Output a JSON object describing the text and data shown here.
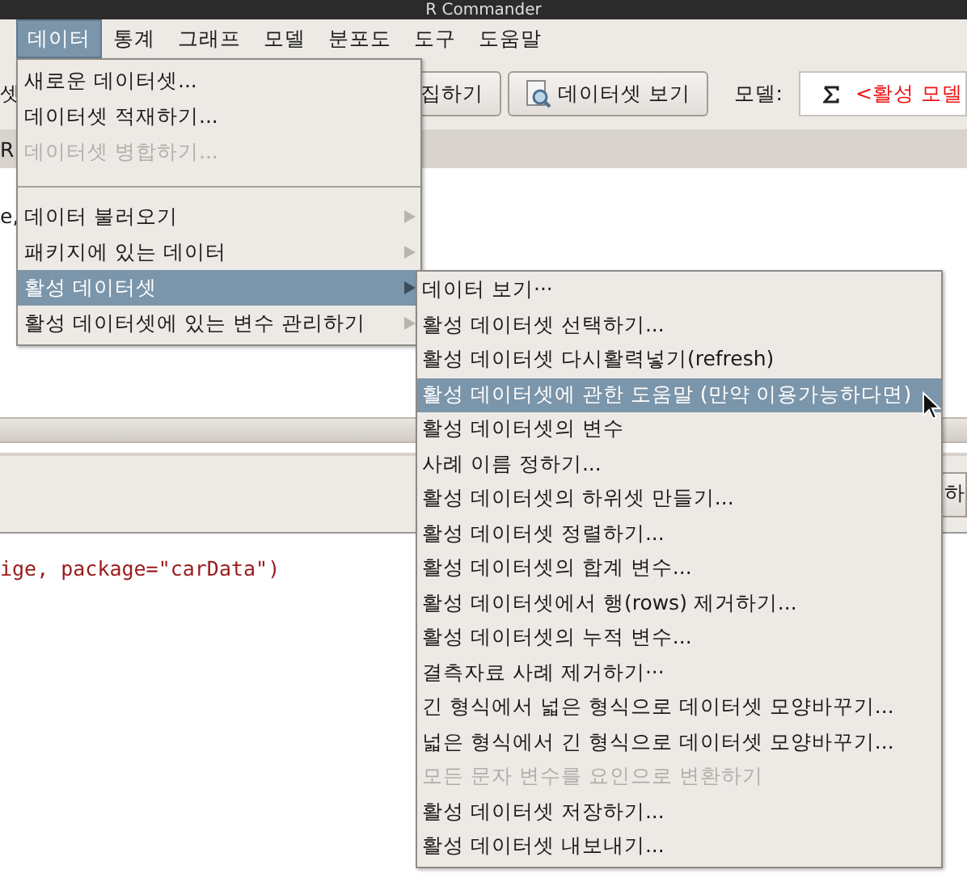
{
  "window": {
    "title": "R Commander"
  },
  "menubar": [
    {
      "label": "데이터",
      "selected": true
    },
    {
      "label": "통계",
      "selected": false
    },
    {
      "label": "그래프",
      "selected": false
    },
    {
      "label": "모델",
      "selected": false
    },
    {
      "label": "분포도",
      "selected": false
    },
    {
      "label": "도구",
      "selected": false
    },
    {
      "label": "도움말",
      "selected": false
    }
  ],
  "toolbar": {
    "fragment": "셋",
    "edit_button": "집하기",
    "view_button": "데이터셋 보기",
    "model_label": "모델:",
    "model_value": "<활성 모델"
  },
  "script_tab_fragment": "R",
  "script_text": "e,",
  "run_button": "하",
  "output_line": "ige, package=\"carData\")",
  "data_menu": [
    {
      "kind": "item",
      "label": "새로운 데이터셋...",
      "disabled": false,
      "submenu": false,
      "selected": false
    },
    {
      "kind": "item",
      "label": "데이터셋 적재하기...",
      "disabled": false,
      "submenu": false,
      "selected": false
    },
    {
      "kind": "item",
      "label": "데이터셋 병합하기...",
      "disabled": true,
      "submenu": false,
      "selected": false
    },
    {
      "kind": "separator"
    },
    {
      "kind": "item",
      "label": "데이터 불러오기",
      "disabled": false,
      "submenu": true,
      "selected": false
    },
    {
      "kind": "item",
      "label": "패키지에 있는 데이터",
      "disabled": false,
      "submenu": true,
      "selected": false
    },
    {
      "kind": "item",
      "label": "활성 데이터셋",
      "disabled": false,
      "submenu": true,
      "selected": true
    },
    {
      "kind": "item",
      "label": "활성 데이터셋에 있는 변수 관리하기",
      "disabled": false,
      "submenu": true,
      "selected": false
    }
  ],
  "active_dataset_menu": [
    {
      "label": "데이터 보기···",
      "disabled": false,
      "selected": false
    },
    {
      "label": "활성 데이터셋 선택하기...",
      "disabled": false,
      "selected": false
    },
    {
      "label": "활성 데이터셋 다시활력넣기(refresh)",
      "disabled": false,
      "selected": false
    },
    {
      "label": "활성 데이터셋에 관한 도움말 (만약 이용가능하다면)",
      "disabled": false,
      "selected": true
    },
    {
      "label": "활성 데이터셋의 변수",
      "disabled": false,
      "selected": false
    },
    {
      "label": "사례 이름 정하기...",
      "disabled": false,
      "selected": false
    },
    {
      "label": "활성 데이터셋의 하위셋 만들기...",
      "disabled": false,
      "selected": false
    },
    {
      "label": "활성 데이터셋 정렬하기...",
      "disabled": false,
      "selected": false
    },
    {
      "label": "활성 데이터셋의 합계 변수...",
      "disabled": false,
      "selected": false
    },
    {
      "label": "활성 데이터셋에서 행(rows) 제거하기...",
      "disabled": false,
      "selected": false
    },
    {
      "label": "활성 데이터셋의 누적 변수...",
      "disabled": false,
      "selected": false
    },
    {
      "label": "결측자료 사례 제거하기···",
      "disabled": false,
      "selected": false
    },
    {
      "label": "긴 형식에서 넓은 형식으로 데이터셋 모양바꾸기...",
      "disabled": false,
      "selected": false
    },
    {
      "label": "넓은 형식에서 긴 형식으로 데이터셋 모양바꾸기...",
      "disabled": false,
      "selected": false
    },
    {
      "label": "모든 문자 변수를 요인으로 변환하기",
      "disabled": true,
      "selected": false
    },
    {
      "label": "활성 데이터셋 저장하기...",
      "disabled": false,
      "selected": false
    },
    {
      "label": "활성 데이터셋 내보내기...",
      "disabled": false,
      "selected": false
    }
  ]
}
